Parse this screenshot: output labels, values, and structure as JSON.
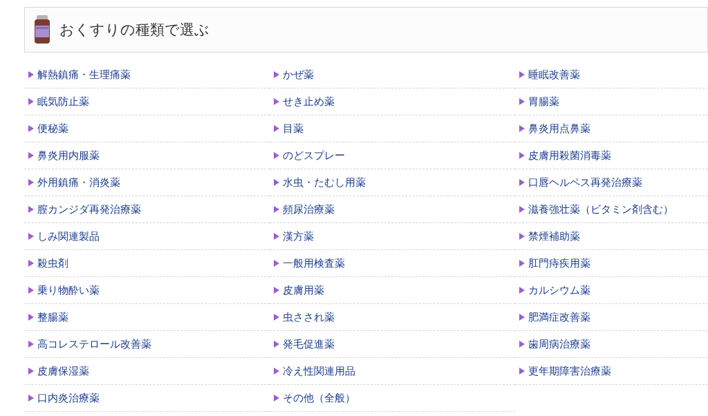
{
  "header": {
    "title": "おくすりの種類で選ぶ"
  },
  "categories": [
    {
      "label": "解熱鎮痛・生理痛薬"
    },
    {
      "label": "かぜ薬"
    },
    {
      "label": "睡眠改善薬"
    },
    {
      "label": "眠気防止薬"
    },
    {
      "label": "せき止め薬"
    },
    {
      "label": "胃腸薬"
    },
    {
      "label": "便秘薬"
    },
    {
      "label": "目薬"
    },
    {
      "label": "鼻炎用点鼻薬"
    },
    {
      "label": "鼻炎用内服薬"
    },
    {
      "label": "のどスプレー"
    },
    {
      "label": "皮膚用殺菌消毒薬"
    },
    {
      "label": "外用鎮痛・消炎薬"
    },
    {
      "label": "水虫・たむし用薬"
    },
    {
      "label": "口唇ヘルペス再発治療薬"
    },
    {
      "label": "膣カンジダ再発治療薬"
    },
    {
      "label": "頻尿治療薬"
    },
    {
      "label": "滋養強壮薬（ビタミン剤含む）"
    },
    {
      "label": "しみ関連製品"
    },
    {
      "label": "漢方薬"
    },
    {
      "label": "禁煙補助薬"
    },
    {
      "label": "殺虫剤"
    },
    {
      "label": "一般用検査薬"
    },
    {
      "label": "肛門痔疾用薬"
    },
    {
      "label": "乗り物酔い薬"
    },
    {
      "label": "皮膚用薬"
    },
    {
      "label": "カルシウム薬"
    },
    {
      "label": "整腸薬"
    },
    {
      "label": "虫さされ薬"
    },
    {
      "label": "肥満症改善薬"
    },
    {
      "label": "高コレステロール改善薬"
    },
    {
      "label": "発毛促進薬"
    },
    {
      "label": "歯周病治療薬"
    },
    {
      "label": "皮膚保湿薬"
    },
    {
      "label": "冷え性関連用品"
    },
    {
      "label": "更年期障害治療薬"
    },
    {
      "label": "口内炎治療薬"
    },
    {
      "label": "その他（全般）"
    }
  ]
}
